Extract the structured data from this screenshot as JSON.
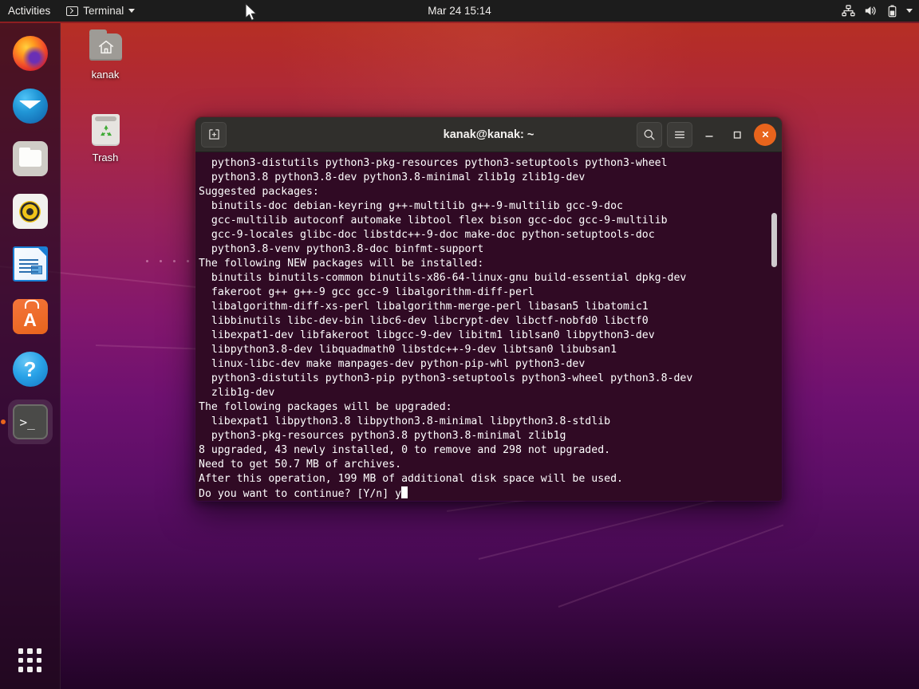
{
  "topbar": {
    "activities": "Activities",
    "app_menu": {
      "label": "Terminal",
      "icon": "terminal-icon",
      "caret": "chevron-down-icon"
    },
    "clock": "Mar 24  15:14",
    "tray_icons": [
      "network-wired-icon",
      "volume-icon",
      "battery-icon",
      "chevron-down-icon"
    ]
  },
  "dock": {
    "items": [
      {
        "name": "firefox",
        "label": "Firefox",
        "running": false
      },
      {
        "name": "thunderbird",
        "label": "Thunderbird Mail",
        "running": false
      },
      {
        "name": "files",
        "label": "Files",
        "running": false
      },
      {
        "name": "rhythmbox",
        "label": "Rhythmbox",
        "running": false
      },
      {
        "name": "libreoffice-writer",
        "label": "LibreOffice Writer",
        "running": false
      },
      {
        "name": "ubuntu-software",
        "label": "Ubuntu Software",
        "running": false,
        "glyph": "A"
      },
      {
        "name": "help",
        "label": "Help",
        "running": false,
        "glyph": "?"
      },
      {
        "name": "terminal",
        "label": "Terminal",
        "running": true,
        "glyph": ">_"
      }
    ],
    "show_applications": "Show Applications"
  },
  "desktop_icons": [
    {
      "name": "home-folder",
      "label": "kanak",
      "icon": "home-folder-icon"
    },
    {
      "name": "trash",
      "label": "Trash",
      "icon": "trash-icon"
    }
  ],
  "terminal": {
    "title": "kanak@kanak: ~",
    "new_tab_label": "New Tab",
    "search_label": "Search",
    "menu_label": "Menu",
    "minimize_label": "Minimize",
    "maximize_label": "Maximize",
    "close_label": "Close",
    "background_color": "#300a24",
    "text_color": "#ffffff",
    "output": "  python3-distutils python3-pkg-resources python3-setuptools python3-wheel\n  python3.8 python3.8-dev python3.8-minimal zlib1g zlib1g-dev\nSuggested packages:\n  binutils-doc debian-keyring g++-multilib g++-9-multilib gcc-9-doc\n  gcc-multilib autoconf automake libtool flex bison gcc-doc gcc-9-multilib\n  gcc-9-locales glibc-doc libstdc++-9-doc make-doc python-setuptools-doc\n  python3.8-venv python3.8-doc binfmt-support\nThe following NEW packages will be installed:\n  binutils binutils-common binutils-x86-64-linux-gnu build-essential dpkg-dev\n  fakeroot g++ g++-9 gcc gcc-9 libalgorithm-diff-perl\n  libalgorithm-diff-xs-perl libalgorithm-merge-perl libasan5 libatomic1\n  libbinutils libc-dev-bin libc6-dev libcrypt-dev libctf-nobfd0 libctf0\n  libexpat1-dev libfakeroot libgcc-9-dev libitm1 liblsan0 libpython3-dev\n  libpython3.8-dev libquadmath0 libstdc++-9-dev libtsan0 libubsan1\n  linux-libc-dev make manpages-dev python-pip-whl python3-dev\n  python3-distutils python3-pip python3-setuptools python3-wheel python3.8-dev\n  zlib1g-dev\nThe following packages will be upgraded:\n  libexpat1 libpython3.8 libpython3.8-minimal libpython3.8-stdlib\n  python3-pkg-resources python3.8 python3.8-minimal zlib1g\n8 upgraded, 43 newly installed, 0 to remove and 298 not upgraded.\nNeed to get 50.7 MB of archives.\nAfter this operation, 199 MB of additional disk space will be used.\nDo you want to continue? [Y/n] y"
  },
  "colors": {
    "accent_orange": "#e8641c",
    "terminal_bg": "#300a24",
    "titlebar_bg": "#302f2c",
    "topbar_bg": "#1c1c1c"
  }
}
